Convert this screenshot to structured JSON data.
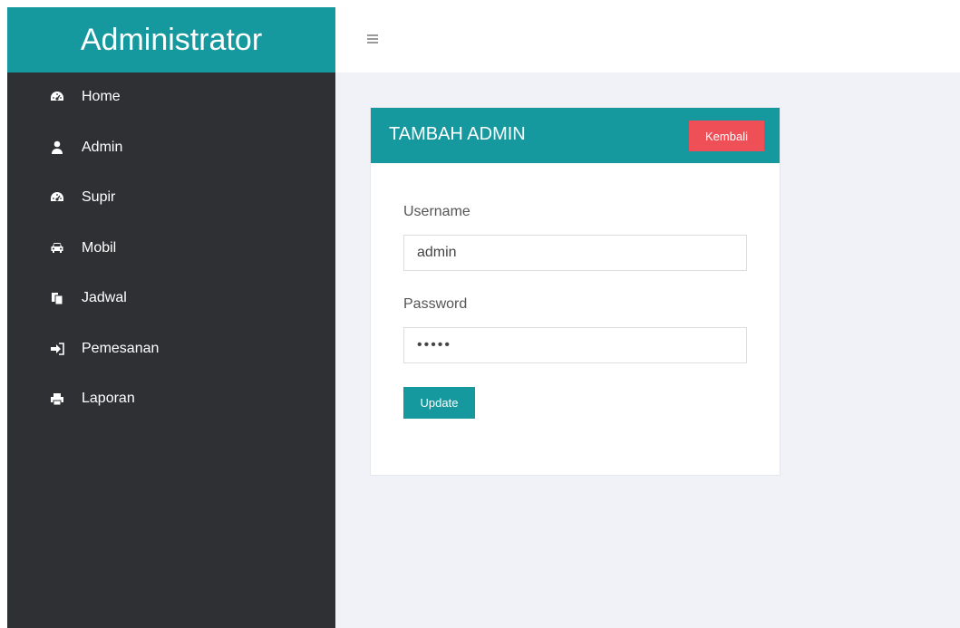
{
  "sidebar": {
    "brand": "Administrator",
    "items": [
      {
        "label": "Home",
        "icon": "dashboard-icon"
      },
      {
        "label": "Admin",
        "icon": "user-icon"
      },
      {
        "label": "Supir",
        "icon": "dashboard-icon"
      },
      {
        "label": "Mobil",
        "icon": "car-icon"
      },
      {
        "label": "Jadwal",
        "icon": "copy-icon"
      },
      {
        "label": "Pemesanan",
        "icon": "sign-in-icon"
      },
      {
        "label": "Laporan",
        "icon": "print-icon"
      }
    ]
  },
  "header": {
    "menu_icon": "hamburger-icon"
  },
  "form": {
    "title": "TAMBAH ADMIN",
    "back_label": "Kembali",
    "username_label": "Username",
    "username_value": "admin",
    "password_label": "Password",
    "password_value": "•••••",
    "submit_label": "Update"
  },
  "colors": {
    "sidebar_bg": "#2f3034",
    "accent": "#16989f",
    "danger": "#ef4f56",
    "content_bg": "#f1f2f7"
  }
}
